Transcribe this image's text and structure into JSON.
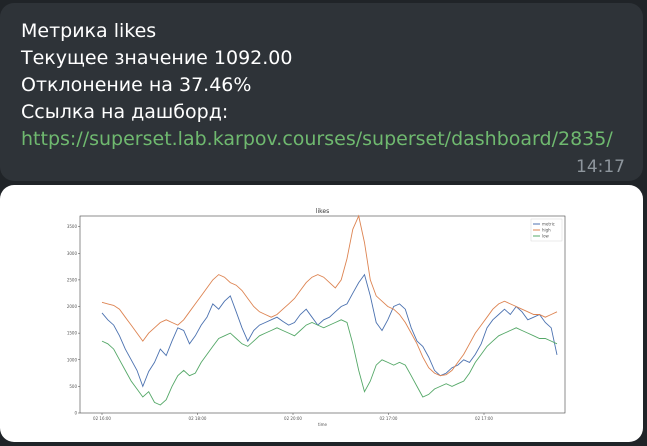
{
  "message": {
    "line1": "Метрика likes",
    "line2": "Текущее значение 1092.00",
    "line3": "Отклонение на 37.46%",
    "line4": "Ссылка на дашборд:",
    "link": "https://superset.lab.karpov.courses/superset/dashboard/2835/",
    "time": "14:17"
  },
  "colors": {
    "metric": "#4c72b0",
    "high": "#dd8452",
    "low": "#55a868",
    "link": "#6fb96f"
  },
  "chart_data": {
    "type": "line",
    "title": "likes",
    "xlabel": "time",
    "ylabel": "",
    "ylim": [
      0,
      3700
    ],
    "yticks": [
      0,
      500,
      1000,
      1500,
      2000,
      2500,
      3000,
      3500
    ],
    "xticks": [
      "02 16:00",
      "02 18:00",
      "02 20:00",
      "02 17:00",
      "02 17:00"
    ],
    "legend_position": "top-right",
    "series": [
      {
        "name": "metric",
        "values": [
          1880,
          1750,
          1650,
          1450,
          1200,
          1000,
          800,
          500,
          780,
          950,
          1200,
          1080,
          1350,
          1600,
          1550,
          1300,
          1450,
          1650,
          1800,
          2050,
          1950,
          2100,
          2200,
          1900,
          1600,
          1350,
          1550,
          1650,
          1700,
          1750,
          1800,
          1720,
          1650,
          1700,
          1850,
          1950,
          1800,
          1650,
          1750,
          1800,
          1900,
          2000,
          2050,
          2250,
          2450,
          2600,
          2200,
          1700,
          1550,
          1750,
          2000,
          2050,
          1950,
          1600,
          1350,
          1250,
          1050,
          800,
          700,
          750,
          850,
          900,
          1000,
          950,
          1100,
          1300,
          1600,
          1750,
          1850,
          1950,
          1850,
          2000,
          1900,
          1750,
          1800,
          1850,
          1700,
          1600,
          1092
        ]
      },
      {
        "name": "high",
        "values": [
          2080,
          2050,
          2020,
          1950,
          1800,
          1650,
          1500,
          1350,
          1500,
          1600,
          1700,
          1750,
          1700,
          1650,
          1750,
          1900,
          2050,
          2200,
          2350,
          2500,
          2600,
          2550,
          2450,
          2400,
          2300,
          2150,
          2000,
          1900,
          1850,
          1800,
          1850,
          1950,
          2050,
          2150,
          2300,
          2450,
          2550,
          2600,
          2550,
          2450,
          2350,
          2500,
          2900,
          3450,
          3700,
          3200,
          2500,
          2200,
          2100,
          2000,
          1950,
          1850,
          1700,
          1500,
          1300,
          1050,
          850,
          750,
          700,
          720,
          800,
          950,
          1100,
          1300,
          1500,
          1650,
          1800,
          1950,
          2050,
          2100,
          2050,
          2000,
          1950,
          1900,
          1850,
          1850,
          1800,
          1850,
          1900
        ]
      },
      {
        "name": "low",
        "values": [
          1350,
          1300,
          1200,
          1000,
          800,
          600,
          450,
          300,
          400,
          200,
          150,
          250,
          500,
          700,
          800,
          700,
          750,
          950,
          1100,
          1250,
          1400,
          1450,
          1500,
          1400,
          1300,
          1250,
          1350,
          1450,
          1500,
          1550,
          1600,
          1550,
          1500,
          1450,
          1550,
          1650,
          1700,
          1650,
          1600,
          1650,
          1700,
          1750,
          1700,
          1300,
          800,
          400,
          600,
          900,
          1000,
          950,
          900,
          950,
          900,
          700,
          500,
          300,
          350,
          450,
          500,
          550,
          500,
          550,
          600,
          750,
          950,
          1100,
          1250,
          1350,
          1450,
          1500,
          1550,
          1600,
          1550,
          1500,
          1450,
          1400,
          1400,
          1350,
          1300
        ]
      }
    ]
  }
}
